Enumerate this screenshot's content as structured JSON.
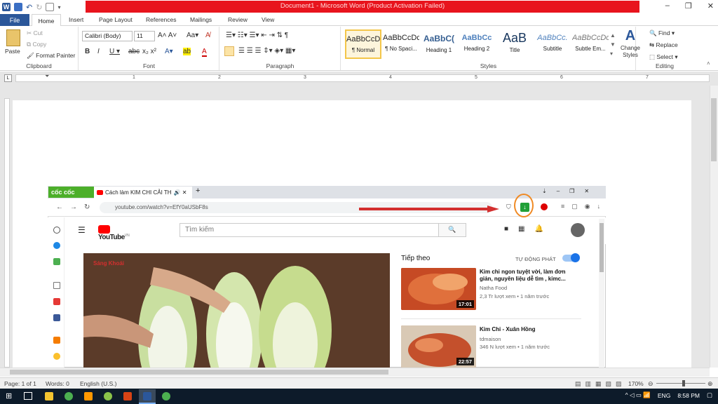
{
  "window": {
    "title": "Document1 - Microsoft Word (Product Activation Failed)",
    "controls": [
      "–",
      "❐",
      "✕"
    ]
  },
  "ribbon_tabs": [
    "File",
    "Home",
    "Insert",
    "Page Layout",
    "References",
    "Mailings",
    "Review",
    "View"
  ],
  "clipboard": {
    "paste": "Paste",
    "cut": "Cut",
    "copy": "Copy",
    "format_painter": "Format Painter",
    "label": "Clipboard"
  },
  "font": {
    "family": "Calibri (Body)",
    "size": "11",
    "label": "Font"
  },
  "paragraph": {
    "label": "Paragraph"
  },
  "styles": {
    "label": "Styles",
    "items": [
      {
        "sample": "AaBbCcDc",
        "name": "¶ Normal"
      },
      {
        "sample": "AaBbCcDc",
        "name": "¶ No Spaci..."
      },
      {
        "sample": "AaBbC(",
        "name": "Heading 1"
      },
      {
        "sample": "AaBbCc",
        "name": "Heading 2"
      },
      {
        "sample": "AaB",
        "name": "Title"
      },
      {
        "sample": "AaBbCc.",
        "name": "Subtitle"
      },
      {
        "sample": "AaBbCcDc",
        "name": "Subtle Em..."
      }
    ],
    "change_styles": "Change Styles"
  },
  "editing": {
    "find": "Find",
    "replace": "Replace",
    "select": "Select",
    "label": "Editing"
  },
  "ruler_numbers": [
    "1",
    "2",
    "3",
    "4",
    "5",
    "6",
    "7"
  ],
  "status": {
    "page": "Page: 1 of 1",
    "words": "Words: 0",
    "language": "English (U.S.)",
    "zoom": "170%"
  },
  "taskbar": {
    "lang": "ENG",
    "time": "8:58 PM"
  },
  "browser": {
    "brand": "cốc cốc",
    "tab_title": "Cách làm KIM CHI CẢI TH",
    "url": "youtube.com/watch?v=EfY0aUSbF8s",
    "search_placeholder": "Tìm kiếm",
    "logo_region": "VN",
    "logo_text": "YouTube",
    "up_next": "Tiếp theo",
    "autoplay": "TỰ ĐỘNG PHÁT",
    "video_overlay": "Sáng Khoái",
    "videos": [
      {
        "title": "Kim chi ngon tuyệt vời, làm đơn giản, nguyên liệu dễ tìm , kimc...",
        "channel": "Natha Food",
        "meta": "2,3 Tr lượt xem • 1 năm trước",
        "duration": "17:01"
      },
      {
        "title": "Kim Chi - Xuân Hồng",
        "channel": "tdmaison",
        "meta": "346 N lượt xem • 1 năm trước",
        "duration": "22:57"
      }
    ]
  },
  "colors": {
    "word_blue": "#2b579a",
    "activation_red": "#e8141d",
    "coccoc_green": "#4caf2a",
    "yt_red": "#ff0000",
    "highlight_orange": "#f08a24"
  }
}
